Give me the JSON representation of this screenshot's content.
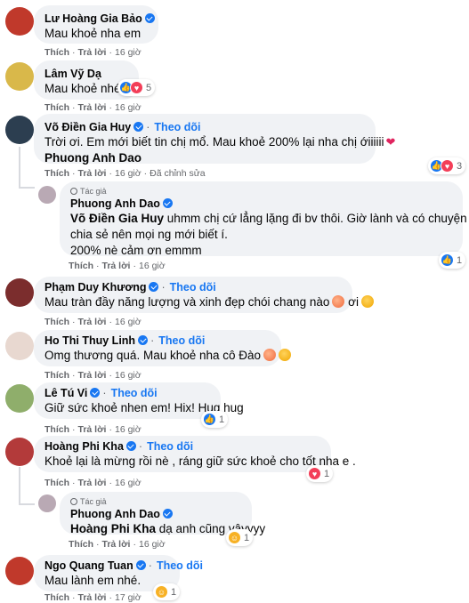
{
  "colors": {
    "accent": "#1877f2",
    "bubble": "#f0f2f5",
    "muted": "#65676b"
  },
  "actions": {
    "like": "Thích",
    "reply": "Trả lời",
    "edited": "Đã chỉnh sửa"
  },
  "follow_label": "Theo dõi",
  "author_role": "Tác giả",
  "comments": [
    {
      "name": "Lư Hoàng Gia Bảo",
      "verified": true,
      "text": "Mau khoẻ nha em",
      "time": "16 giờ",
      "avatar_color": "#c0392b"
    },
    {
      "name": "Lâm Vỹ Dạ",
      "verified": false,
      "text": "Mau khoẻ nhé!",
      "time": "16 giờ",
      "reactions": {
        "icons": [
          "like-icon",
          "love-icon"
        ],
        "count": "5"
      },
      "avatar_color": "#d9b84a"
    },
    {
      "name": "Võ Điền Gia Huy",
      "verified": true,
      "text": "Trời ơi. Em mới biết tin chị mổ. Mau khoẻ 200% lại nha chị ớiiiiii",
      "mention": "Phuong Anh Dao",
      "time": "16 giờ",
      "reactions": {
        "icons": [
          "like-icon",
          "love-icon"
        ],
        "count": "3"
      },
      "avatar_color": "#2c3e50"
    },
    {
      "name": "Phuong Anh Dao",
      "role": true,
      "verified": true,
      "mention": "Võ Điền Gia Huy",
      "text_line1": "uhmm chị cứ lẳng lặng đi bv thôi. Giờ lành và có chuyện để",
      "text_line2": "chia sẻ nên mọi ng mới biết í.",
      "text_line3": "200% nè cảm ơn emmm",
      "time": "16 giờ",
      "reactions": {
        "icons": [
          "like-icon"
        ],
        "count": "1"
      },
      "avatar_color": "#b9a9b4"
    },
    {
      "name": "Phạm Duy Khương",
      "verified": true,
      "text": "Mau tràn đầy năng lượng và xinh đẹp chói chang nào",
      "text_tail": "ơi",
      "time": "16 giờ",
      "avatar_color": "#7b2d2d"
    },
    {
      "name": "Ho Thi Thuy Linh",
      "verified": true,
      "text": "Omg thương quá. Mau khoẻ nha cô Đào",
      "time": "16 giờ",
      "avatar_color": "#e8d8d0"
    },
    {
      "name": "Lê Tú Vi",
      "verified": true,
      "text": "Giữ sức khoẻ nhen em! Hix! Hug hug",
      "time": "16 giờ",
      "reactions": {
        "icons": [
          "like-icon"
        ],
        "count": "1"
      },
      "avatar_color": "#8fae6b"
    },
    {
      "name": "Hoàng Phi Kha",
      "verified": true,
      "text": "Khoẻ lại là mừng rồi nè , ráng giữ sức khoẻ cho tốt nha e .",
      "time": "16 giờ",
      "reactions": {
        "icons": [
          "love-icon"
        ],
        "count": "1"
      },
      "avatar_color": "#b33a3a"
    },
    {
      "name": "Phuong Anh Dao",
      "role": true,
      "verified": true,
      "mention": "Hoàng Phi Kha",
      "text": "dạ anh cũng vậyyyy",
      "time": "16 giờ",
      "reactions": {
        "icons": [
          "care-icon"
        ],
        "count": "1"
      },
      "avatar_color": "#b9a9b4"
    },
    {
      "name": "Ngo Quang Tuan",
      "verified": true,
      "text": "Mau lành em nhé.",
      "time": "17 giờ",
      "reactions": {
        "icons": [
          "care-icon"
        ],
        "count": "1"
      },
      "avatar_color": "#c0392b"
    }
  ]
}
